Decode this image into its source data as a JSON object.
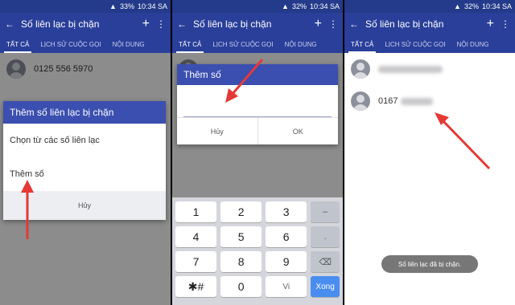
{
  "status": {
    "battery": "33%",
    "battery2": "32%",
    "time": "10:34 SA"
  },
  "appbar": {
    "title": "Số liên lạc bị chặn",
    "plus": "+",
    "menu": "⋮",
    "back": "←"
  },
  "tabs": [
    "TẤT CẢ",
    "LỊCH SỬ CUỘC GỌI",
    "NỘI DUNG"
  ],
  "panel1": {
    "contact_number": "0125 556 5970",
    "dialog_title": "Thêm số liên lạc bị chặn",
    "option_choose": "Chọn từ các số liên lạc",
    "option_add": "Thêm số",
    "cancel": "Hủy"
  },
  "panel2": {
    "dialog_title": "Thêm số",
    "cancel": "Hủy",
    "ok": "OK",
    "keys": [
      [
        "1",
        "2",
        "3",
        "–"
      ],
      [
        "4",
        "5",
        "6",
        "."
      ],
      [
        "7",
        "8",
        "9",
        "⌫"
      ],
      [
        "✱#",
        "0",
        "Vi",
        "Xong"
      ]
    ]
  },
  "panel3": {
    "contact2_prefix": "0167",
    "toast": "Số liên lạc đã bị chặn."
  },
  "colors": {
    "primary": "#2a3f9a",
    "accent": "#e53935"
  }
}
